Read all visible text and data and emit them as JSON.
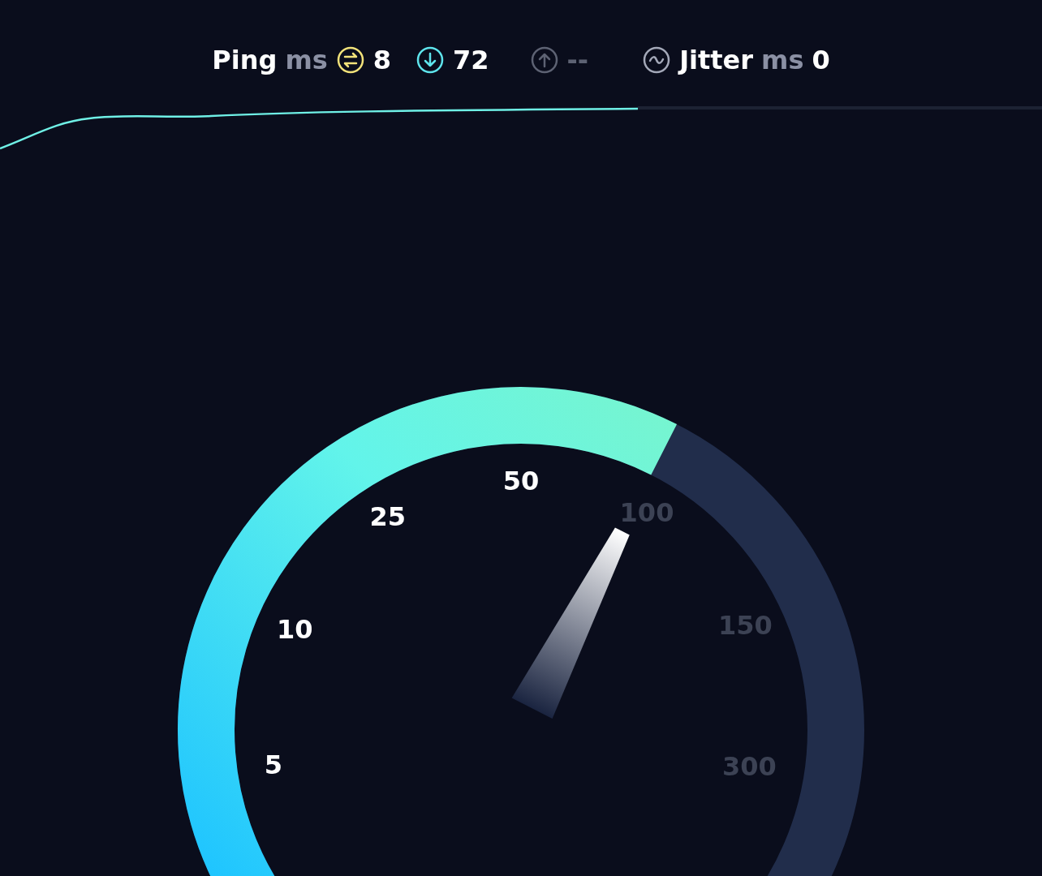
{
  "stats": {
    "ping_label": "Ping",
    "ping_unit": "ms",
    "ping": "8",
    "download": "72",
    "upload": "--",
    "upload_active": false,
    "jitter_label": "Jitter",
    "jitter_unit": "ms",
    "jitter": "0"
  },
  "gauge": {
    "scale": [
      {
        "label": "5",
        "active": true
      },
      {
        "label": "10",
        "active": true
      },
      {
        "label": "25",
        "active": true
      },
      {
        "label": "50",
        "active": true
      },
      {
        "label": "100",
        "active": false
      },
      {
        "label": "150",
        "active": false
      },
      {
        "label": "300",
        "active": false
      }
    ]
  }
}
